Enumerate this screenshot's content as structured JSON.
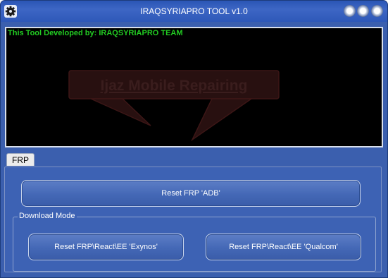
{
  "window": {
    "title": "IRAQSYRIAPRO TOOL v1.0"
  },
  "output": {
    "banner": "This Tool Developed by: IRAQSYRIAPRO TEAM",
    "watermark": "Ijaz Mobile Repairing"
  },
  "tabs": [
    {
      "label": "FRP",
      "selected": true
    }
  ],
  "frp": {
    "reset_adb_label": "Reset FRP 'ADB'",
    "download_mode": {
      "legend": "Download Mode",
      "exynos_label": "Reset FRP\\React\\EE 'Exynos'",
      "qualcom_label": "Reset FRP\\React\\EE 'Qualcom'"
    }
  },
  "icons": {
    "app": "settings-gear-icon",
    "window_controls": [
      "help-icon",
      "minimize-icon",
      "close-icon"
    ]
  },
  "colors": {
    "window_background": "#3b5fae",
    "output_background": "#000000",
    "banner_text": "#22cc22",
    "watermark_text": "#3a1d1d"
  }
}
